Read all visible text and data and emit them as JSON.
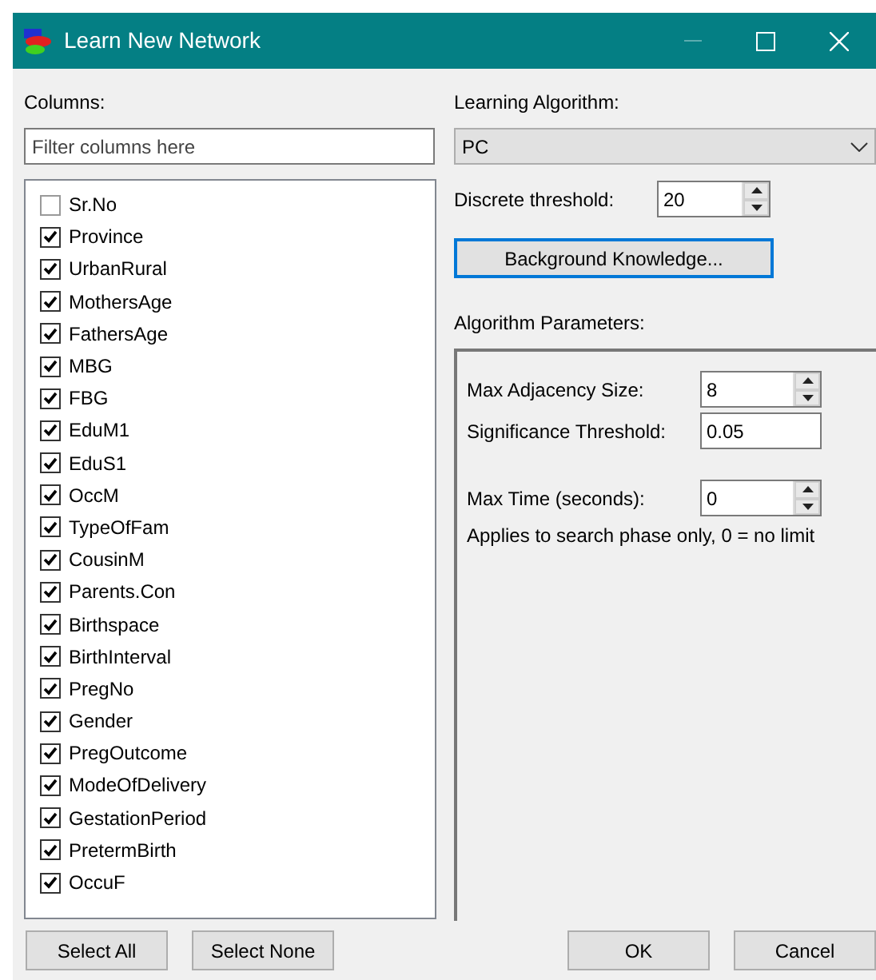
{
  "window": {
    "title": "Learn New Network",
    "minimize_disabled": true
  },
  "columns_label": "Columns:",
  "filter": {
    "placeholder": "Filter columns here"
  },
  "columns": [
    {
      "label": "Sr.No",
      "checked": false
    },
    {
      "label": "Province",
      "checked": true
    },
    {
      "label": "UrbanRural",
      "checked": true
    },
    {
      "label": "MothersAge",
      "checked": true
    },
    {
      "label": "FathersAge",
      "checked": true
    },
    {
      "label": "MBG",
      "checked": true
    },
    {
      "label": "FBG",
      "checked": true
    },
    {
      "label": "EduM1",
      "checked": true
    },
    {
      "label": "EduS1",
      "checked": true
    },
    {
      "label": "OccM",
      "checked": true
    },
    {
      "label": "TypeOfFam",
      "checked": true
    },
    {
      "label": "CousinM",
      "checked": true
    },
    {
      "label": "Parents.Con",
      "checked": true
    },
    {
      "label": "Birthspace",
      "checked": true
    },
    {
      "label": "BirthInterval",
      "checked": true
    },
    {
      "label": "PregNo",
      "checked": true
    },
    {
      "label": "Gender",
      "checked": true
    },
    {
      "label": "PregOutcome",
      "checked": true
    },
    {
      "label": "ModeOfDelivery",
      "checked": true
    },
    {
      "label": "GestationPeriod",
      "checked": true
    },
    {
      "label": "PretermBirth",
      "checked": true
    },
    {
      "label": "OccuF",
      "checked": true
    }
  ],
  "algorithm": {
    "label": "Learning Algorithm:",
    "value": "PC"
  },
  "discrete_threshold": {
    "label": "Discrete threshold:",
    "value": "20"
  },
  "background_button": "Background Knowledge...",
  "parameters": {
    "label": "Algorithm Parameters:",
    "field_groups": [
      [
        {
          "kind": "spinner",
          "label": "Max Adjacency Size:",
          "value": "8"
        },
        {
          "kind": "text",
          "label": "Significance Threshold:",
          "value": "0.05"
        }
      ],
      [
        {
          "kind": "spinner",
          "label": "Max Time (seconds):",
          "value": "0"
        }
      ]
    ],
    "note": "Applies to search phase only, 0 = no limit"
  },
  "left_buttons": [
    "Select All",
    "Select None"
  ],
  "right_buttons": [
    "OK",
    "Cancel"
  ]
}
